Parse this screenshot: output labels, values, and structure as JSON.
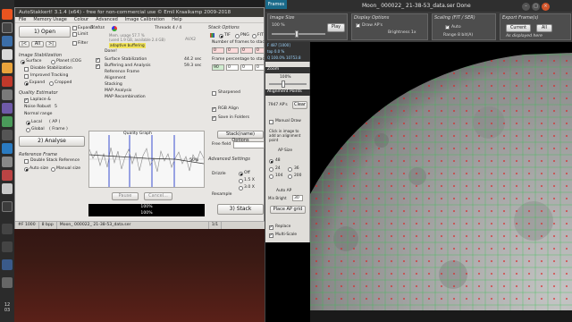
{
  "launcher": {
    "clock_hour": "12",
    "clock_min": "03"
  },
  "as_window": {
    "title": "AutoStakkert! 3.1.4 (x64) - free for non-commercial use © Emil Kraaikamp 2009-2018",
    "menu": [
      "File",
      "Memory Usage",
      "Colour",
      "Advanced",
      "Image Calibration",
      "Help"
    ],
    "open_button": "1) Open",
    "expand_label": "Expand",
    "limit_label": "Limit",
    "filter_label": "Filter",
    "small_buttons": [
      "|<",
      "All",
      ">|"
    ],
    "stabilization": {
      "title": "Image Stabilization",
      "surface": "Surface",
      "planet": "Planet (COG",
      "disable": "Disable Stabilization",
      "improved": "Improved Tracking",
      "expand": "Expand",
      "cropped": "Cropped"
    },
    "quality": {
      "title": "Quality Estimator",
      "laplace": "Laplace &",
      "noise_robust": "Noise Robust",
      "noise_value": "5",
      "normalize": "Normal range",
      "local": "Local",
      "local_ap": "( AP )",
      "global": "Global",
      "global_frame": "( Frame )"
    },
    "analyse_button": "2) Analyse",
    "reference": {
      "title": "Reference Frame",
      "double_stack": "Double Stack Reference",
      "auto_size": "Auto size",
      "manual_size": "Manual size"
    },
    "status": {
      "title": "Status",
      "threads": "Threads 4 / 4",
      "mem_line1": "Mem. usage 57.7 %",
      "mem_line2": "(used 1.9 GB, available 2.4 GB)",
      "avx2": "AVX2",
      "adaptive": "adaptive buffering",
      "done": "Done!",
      "steps": [
        {
          "name": "Surface Stabilization",
          "time": "44.2 sec"
        },
        {
          "name": "Buffering and Analysis",
          "time": "59.3 sec"
        },
        {
          "name": "Reference Frame",
          "time": ""
        },
        {
          "name": "Alignment",
          "time": ""
        },
        {
          "name": "Stacking",
          "time": ""
        },
        {
          "name": "MAP Analysis",
          "time": ""
        },
        {
          "name": "MAP Recombination",
          "time": ""
        }
      ],
      "graph_title": "Quality Graph",
      "graph_pct": "50%",
      "pause": "Pause",
      "cancel": "Cancel...",
      "progress1": "100%",
      "progress2": "100%",
      "progress1_value": 1.0,
      "progress2_value": 1.0
    },
    "stack": {
      "title": "Stack Options",
      "tif": "TIF",
      "png": "PNG",
      "fit": "FIT",
      "frames_label": "Number of frames to stack",
      "frames_values": [
        "0",
        "0",
        "0",
        "0"
      ],
      "pct_label": "Frame percentage to stack",
      "pct_values": [
        "90",
        "0",
        "0",
        "0"
      ],
      "sharpened": "Sharpened",
      "rgb_align": "RGB Align",
      "save_folders": "Save in Folders",
      "stack_name_btn": "Stack(name) Options",
      "free_field": "Free field",
      "advanced": "Advanced Settings",
      "drizzle": "Drizzle",
      "off": "Off",
      "d15": "1.5 X",
      "d30": "3.0 X",
      "resample": "Resample",
      "stack_button": "3) Stack"
    },
    "statusbar": [
      "#F 1000",
      "8 bpp",
      "Moon_ 000022_ 21-38-53_data.ser",
      "1/1"
    ]
  },
  "viewer": {
    "frames_badge": "Frames",
    "title": "Moon_ 000022_ 21-38-53_data.ser  Done",
    "win_controls": [
      "–",
      "□",
      "×"
    ],
    "image_size_title": "Image Size",
    "image_size_pct": "100 %",
    "play_btn": "Play",
    "display_title": "Display Options",
    "draw_aps": "Draw AP's",
    "brightness": "Brightness 1x",
    "scaling_title": "Scaling (FIT / SER)",
    "auto": "Auto",
    "range": "Range 8 bit(A)",
    "export_title": "Export Frame(s)",
    "current_btn": "Current",
    "all_btn": "All",
    "as_displayed": "As displayed here",
    "side": {
      "info_lines": [
        "F 487 [1000]",
        "top 0.0 %",
        "Q 100.0%  10753.8"
      ],
      "zoom_title": "Zoom",
      "zoom_value": "100%",
      "alignment_title": "Alignment Points",
      "aps_count": "7947 AP's",
      "clear_btn": "Clear",
      "manual_draw": "Manual Draw",
      "click_info": "Click in image to add an alignment point",
      "ap_size": "AP Size",
      "ap_48": "48",
      "ap_24": "24",
      "ap_36": "36",
      "ap_104": "104",
      "ap_200": "200",
      "auto_ap": "Auto AP",
      "min_bright": "Min Bright",
      "min_bright_val": "30",
      "place_grid": "Place AP grid",
      "replace": "Replace",
      "multi_scale": "Multi-Scale"
    }
  },
  "colors": {
    "accent_blue": "#1a6a8a",
    "launcher_bg": "#2b2b2b",
    "ap_red": "#e02020",
    "ap_grid": "#2ec24a"
  }
}
